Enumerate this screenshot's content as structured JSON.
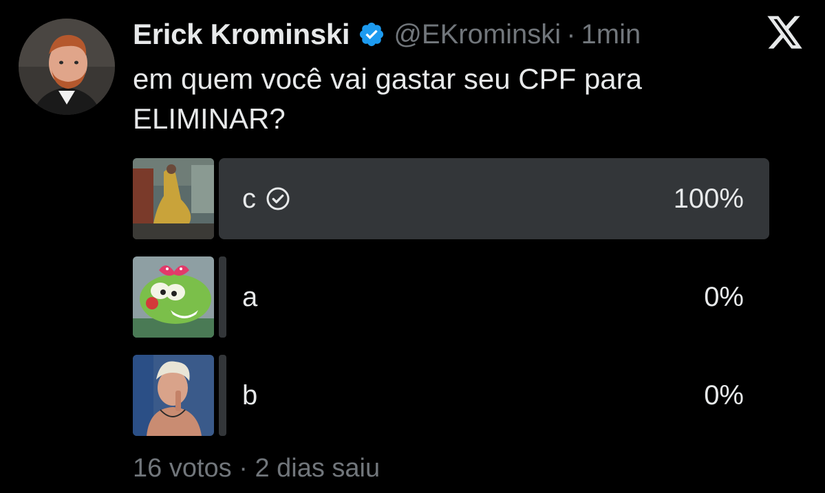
{
  "tweet": {
    "author_name": "Erick Krominski",
    "handle": "@EKrominski",
    "separator": "·",
    "time": "1min",
    "text": "em quem você vai gastar seu CPF para ELIMINAR?"
  },
  "poll": {
    "options": [
      {
        "label": "c",
        "percent": "100%",
        "selected": true,
        "share": 1.0
      },
      {
        "label": "a",
        "percent": "0%",
        "selected": false,
        "share": 0.0
      },
      {
        "label": "b",
        "percent": "0%",
        "selected": false,
        "share": 0.0
      }
    ],
    "votes": "16 votos",
    "separator": "·",
    "status": "2 dias saiu"
  },
  "icons": {
    "verified": "verified-badge-icon",
    "logo": "x-logo-icon",
    "check": "check-circle-icon"
  },
  "colors": {
    "background": "#000000",
    "text": "#e7e9ea",
    "muted": "#71767b",
    "bar": "#333639",
    "verified": "#1d9bf0"
  }
}
